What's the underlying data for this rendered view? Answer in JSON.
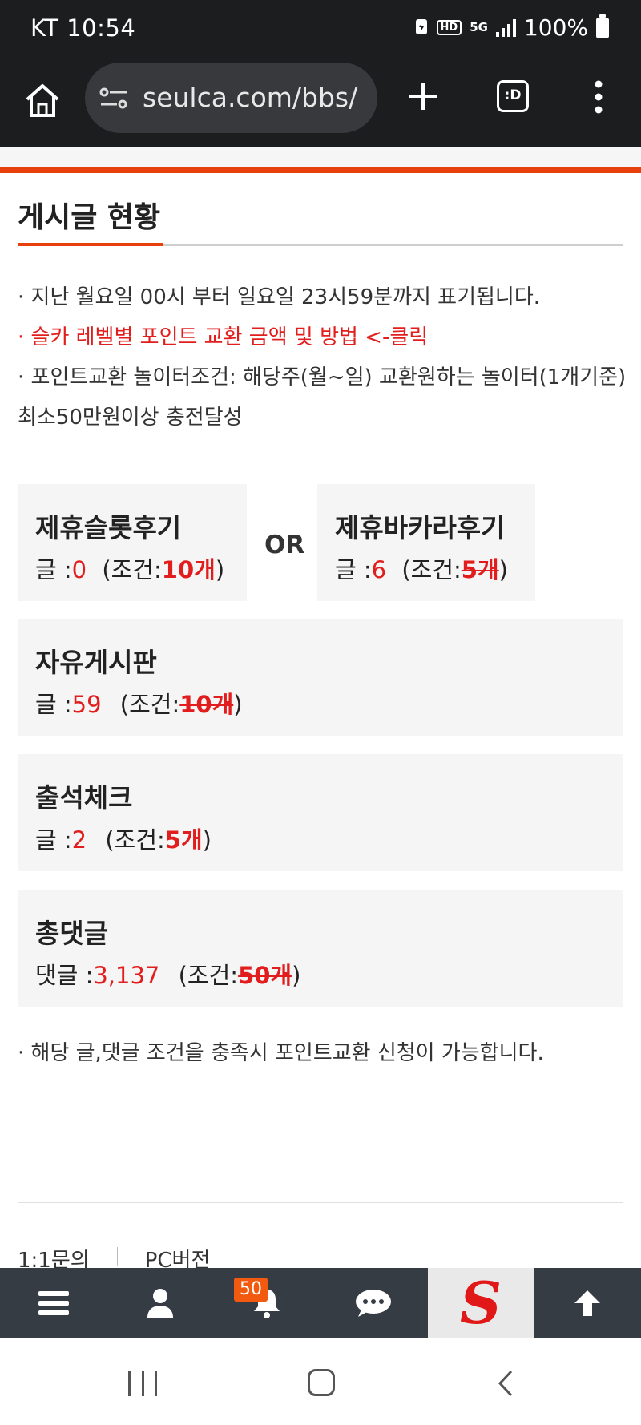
{
  "status_bar": {
    "carrier_time": "KT 10:54",
    "hd": "HD",
    "network": "5G",
    "battery": "100%"
  },
  "browser": {
    "url": "seulca.com/bbs/",
    "tabs_label": ":D"
  },
  "page": {
    "section_title": "게시글 현황",
    "notes": [
      "· 지난 월요일 00시 부터 일요일 23시59분까지 표기됩니다.",
      "· 슬카 레벨별 포인트 교환 금액 및 방법 <-클릭",
      "· 포인트교환 놀이터조건: 해당주(월~일) 교환원하는 놀이터(1개기준) 최소50만원이상 충전달성"
    ],
    "or_label": "OR",
    "cards": [
      {
        "title": "제휴슬롯후기",
        "prefix": "글 :",
        "count": "0",
        "cond_prefix": "(조건:",
        "cond_value": "10개",
        "cond_suffix": ")",
        "met": false
      },
      {
        "title": "제휴바카라후기",
        "prefix": "글 :",
        "count": "6",
        "cond_prefix": "(조건:",
        "cond_value": "5개",
        "cond_suffix": ")",
        "met": true
      },
      {
        "title": "자유게시판",
        "prefix": "글 :",
        "count": "59",
        "cond_prefix": "(조건:",
        "cond_value": "10개",
        "cond_suffix": ")",
        "met": true
      },
      {
        "title": "출석체크",
        "prefix": "글 :",
        "count": "2",
        "cond_prefix": "(조건:",
        "cond_value": "5개",
        "cond_suffix": ")",
        "met": false
      },
      {
        "title": "총댓글",
        "prefix": "댓글 :",
        "count": "3,137",
        "cond_prefix": "(조건:",
        "cond_value": "50개",
        "cond_suffix": ")",
        "met": true
      }
    ],
    "bottom_note": "· 해당 글,댓글 조건을 충족시 포인트교환 신청이 가능합니다.",
    "footer_links": [
      "1:1문의",
      "PC버전"
    ]
  },
  "app_nav": {
    "notification_badge": "50",
    "logo_letter": "S"
  },
  "colors": {
    "accent": "#e8400c",
    "red_text": "#e21d1d",
    "nav_bg": "#363c44",
    "browser_bg": "#1c1d1f"
  },
  "icons": [
    "home-icon",
    "site-settings-icon",
    "new-tab-icon",
    "tab-switcher-icon",
    "more-menu-icon",
    "hamburger-menu-icon",
    "user-icon",
    "bell-icon",
    "chat-icon",
    "arrow-up-icon"
  ]
}
